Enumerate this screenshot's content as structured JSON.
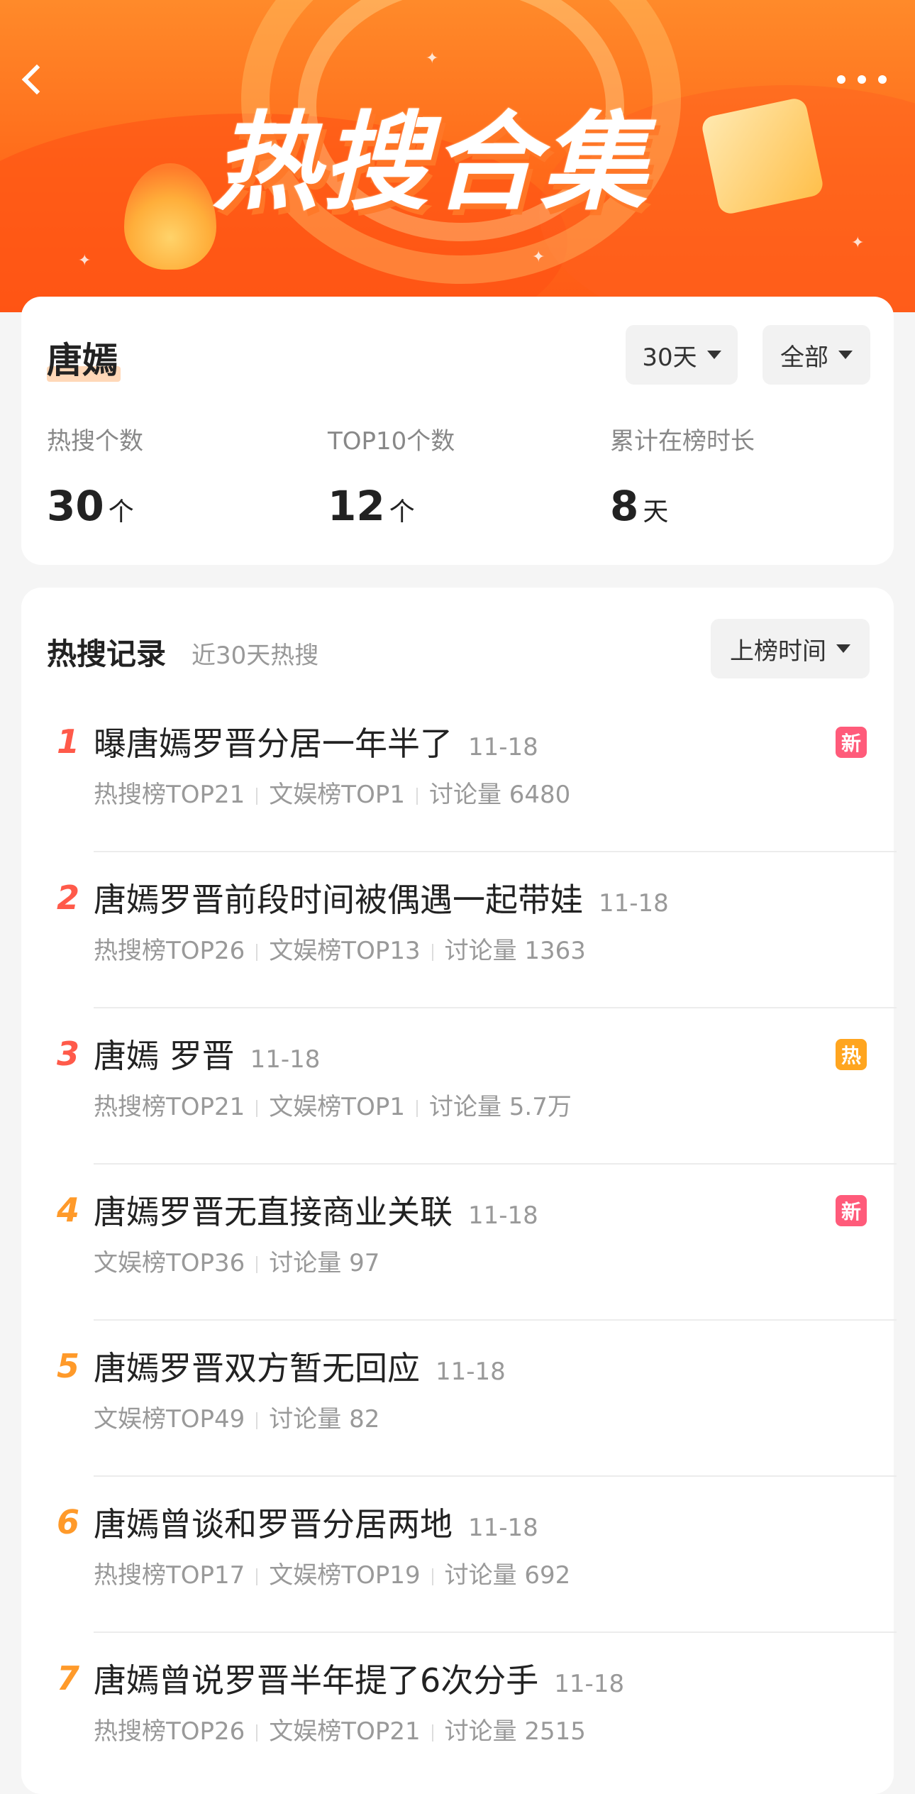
{
  "header": {
    "banner_title": "热搜合集",
    "back_icon": "back-icon",
    "more_icon": "more-icon"
  },
  "summary": {
    "keyword": "唐嫣",
    "filter_days": "30天",
    "filter_type": "全部",
    "stats": [
      {
        "label": "热搜个数",
        "value": "30",
        "unit": "个"
      },
      {
        "label": "TOP10个数",
        "value": "12",
        "unit": "个"
      },
      {
        "label": "累计在榜时长",
        "value": "8",
        "unit": "天"
      }
    ]
  },
  "records": {
    "title": "热搜记录",
    "subtitle": "近30天热搜",
    "sort_label": "上榜时间",
    "items": [
      {
        "rank": "1",
        "title": "曝唐嫣罗晋分居一年半了",
        "date": "11-18",
        "meta": [
          "热搜榜TOP21",
          "文娱榜TOP1",
          "讨论量 6480"
        ],
        "badge": "新"
      },
      {
        "rank": "2",
        "title": "唐嫣罗晋前段时间被偶遇一起带娃",
        "date": "11-18",
        "meta": [
          "热搜榜TOP26",
          "文娱榜TOP13",
          "讨论量 1363"
        ],
        "badge": ""
      },
      {
        "rank": "3",
        "title": "唐嫣 罗晋",
        "date": "11-18",
        "meta": [
          "热搜榜TOP21",
          "文娱榜TOP1",
          "讨论量 5.7万"
        ],
        "badge": "热"
      },
      {
        "rank": "4",
        "title": "唐嫣罗晋无直接商业关联",
        "date": "11-18",
        "meta": [
          "文娱榜TOP36",
          "讨论量 97"
        ],
        "badge": "新"
      },
      {
        "rank": "5",
        "title": "唐嫣罗晋双方暂无回应",
        "date": "11-18",
        "meta": [
          "文娱榜TOP49",
          "讨论量 82"
        ],
        "badge": ""
      },
      {
        "rank": "6",
        "title": "唐嫣曾谈和罗晋分居两地",
        "date": "11-18",
        "meta": [
          "热搜榜TOP17",
          "文娱榜TOP19",
          "讨论量 692"
        ],
        "badge": ""
      },
      {
        "rank": "7",
        "title": "唐嫣曾说罗晋半年提了6次分手",
        "date": "11-18",
        "meta": [
          "热搜榜TOP26",
          "文娱榜TOP21",
          "讨论量 2515"
        ],
        "badge": ""
      }
    ]
  },
  "colors": {
    "rank_top3": "#ff5a4a",
    "rank_rest": "#ff9a2a",
    "badge_new": "#ff5b7a",
    "badge_hot": "#ffa51f"
  }
}
